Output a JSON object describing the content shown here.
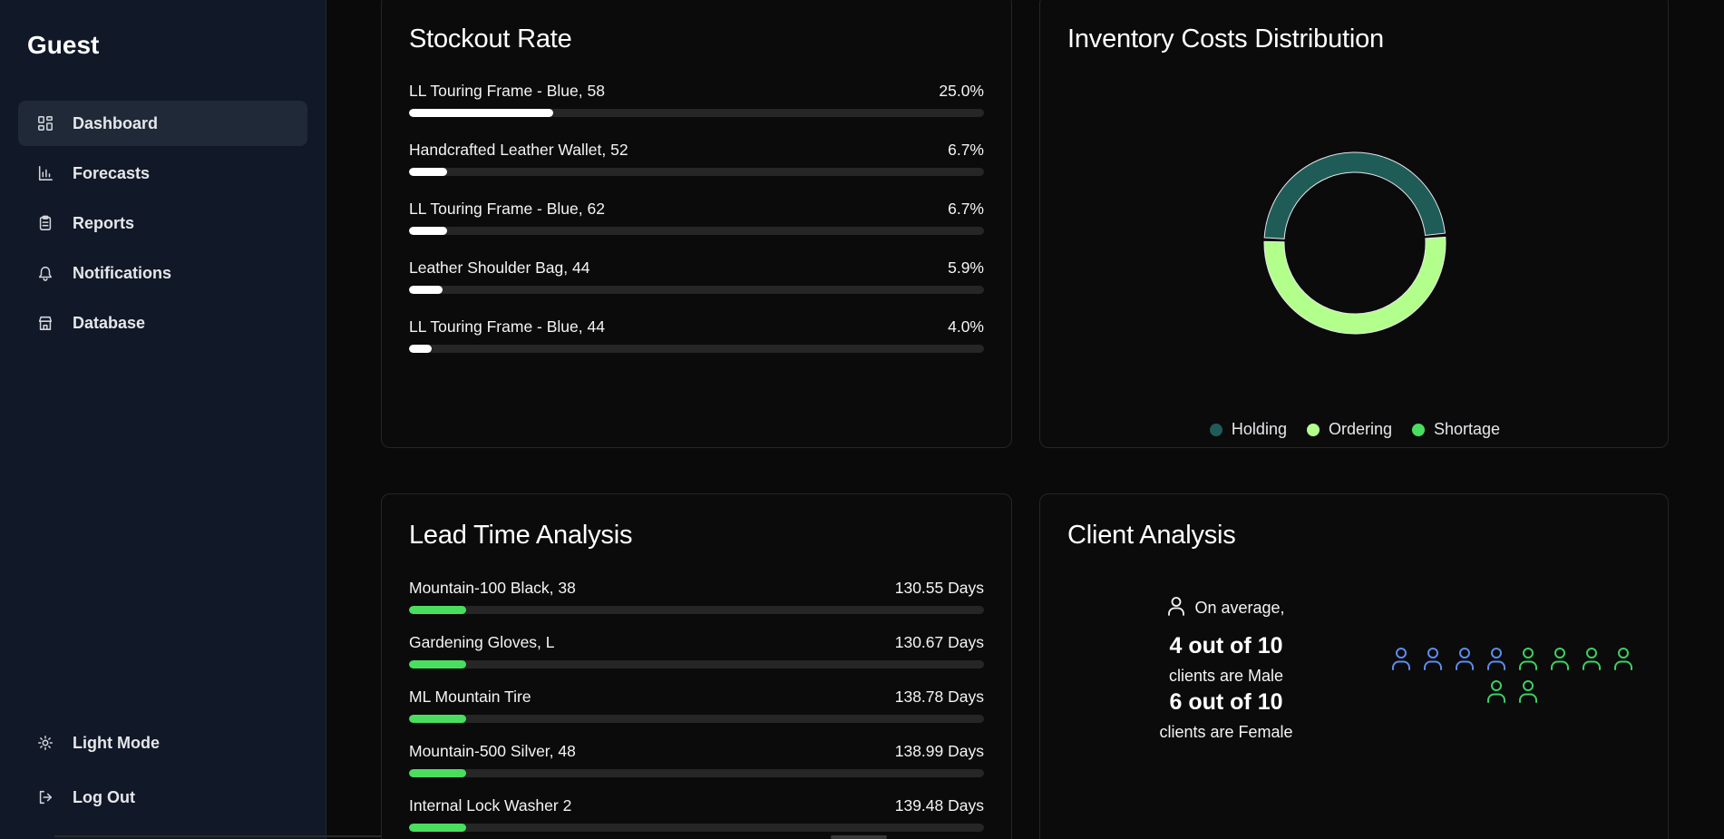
{
  "sidebar": {
    "user_name": "Guest",
    "items": [
      {
        "label": "Dashboard",
        "icon": "dashboard-icon",
        "active": true
      },
      {
        "label": "Forecasts",
        "icon": "chart-icon",
        "active": false
      },
      {
        "label": "Reports",
        "icon": "clipboard-icon",
        "active": false
      },
      {
        "label": "Notifications",
        "icon": "bell-icon",
        "active": false
      },
      {
        "label": "Database",
        "icon": "store-icon",
        "active": false
      }
    ],
    "bottom": [
      {
        "label": "Light Mode",
        "icon": "sun-icon"
      },
      {
        "label": "Log Out",
        "icon": "logout-icon"
      }
    ]
  },
  "stockout": {
    "title": "Stockout Rate",
    "bar_color": "#ffffff",
    "rows": [
      {
        "label": "LL Touring Frame - Blue, 58",
        "value": "25.0%",
        "fraction": 0.25
      },
      {
        "label": "Handcrafted Leather Wallet, 52",
        "value": "6.7%",
        "fraction": 0.067
      },
      {
        "label": "LL Touring Frame - Blue, 62",
        "value": "6.7%",
        "fraction": 0.067
      },
      {
        "label": "Leather Shoulder Bag, 44",
        "value": "5.9%",
        "fraction": 0.059
      },
      {
        "label": "LL Touring Frame - Blue, 44",
        "value": "4.0%",
        "fraction": 0.04
      }
    ]
  },
  "costs": {
    "title": "Inventory Costs Distribution",
    "legend": [
      {
        "label": "Holding",
        "color": "#1f5c57"
      },
      {
        "label": "Ordering",
        "color": "#b2ff8c"
      },
      {
        "label": "Shortage",
        "color": "#4ade5f"
      }
    ],
    "shares": [
      0.48,
      0.52,
      0.0
    ]
  },
  "leadtime": {
    "title": "Lead Time Analysis",
    "bar_color": "#4ade5f",
    "rows": [
      {
        "label": "Mountain-100 Black, 38",
        "value": "130.55 Days",
        "fraction": 0.1
      },
      {
        "label": "Gardening Gloves, L",
        "value": "130.67 Days",
        "fraction": 0.1
      },
      {
        "label": "ML Mountain Tire",
        "value": "138.78 Days",
        "fraction": 0.1
      },
      {
        "label": "Mountain-500 Silver, 48",
        "value": "138.99 Days",
        "fraction": 0.1
      },
      {
        "label": "Internal Lock Washer 2",
        "value": "139.48 Days",
        "fraction": 0.1
      }
    ]
  },
  "clients": {
    "title": "Client Analysis",
    "avg_text": "On average,",
    "male_stat": "4 out of 10",
    "male_text": "clients are Male",
    "female_stat": "6 out of 10",
    "female_text": "clients are Female",
    "male_count": 4,
    "female_count": 6,
    "male_color": "#5b8def",
    "female_color": "#3ccf63"
  }
}
